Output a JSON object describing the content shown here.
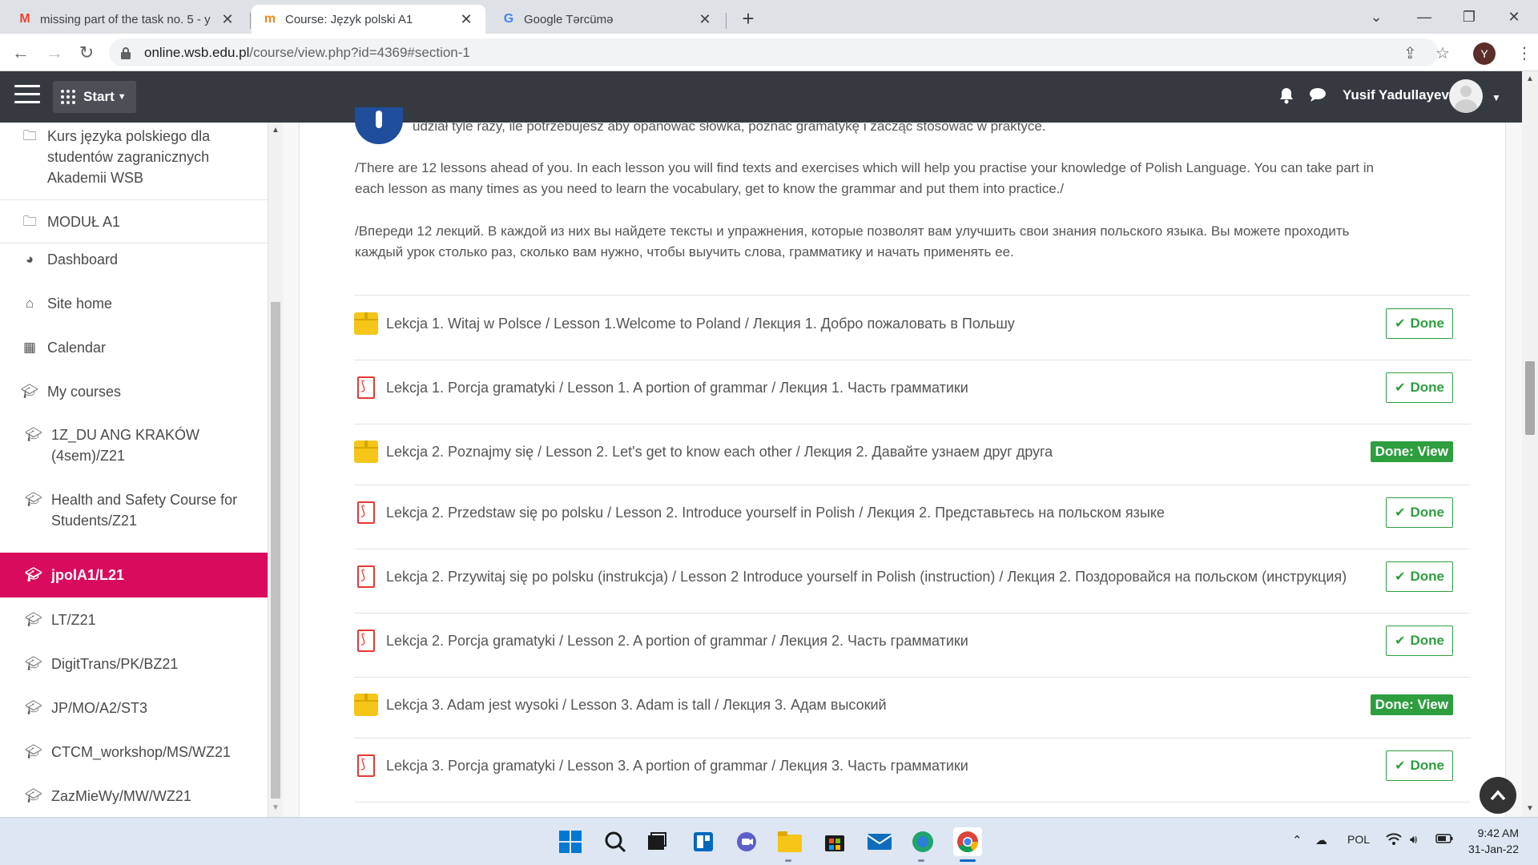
{
  "browser": {
    "tabs": [
      {
        "title": "missing part of the task no. 5 - y",
        "favicon": "gmail-icon",
        "active": false
      },
      {
        "title": "Course: Język polski A1",
        "favicon": "moodle-icon",
        "active": true
      },
      {
        "title": "Google Tərcümə",
        "favicon": "google-translate-icon",
        "active": false
      }
    ],
    "url_host": "online.wsb.edu.pl",
    "url_path": "/course/view.php?id=4369#section-1",
    "profile_initial": "Y"
  },
  "navbar": {
    "start_label": "Start",
    "user_name": "Yusif Yadullayev"
  },
  "drawer": {
    "items": [
      {
        "label": "Kurs języka polskiego dla studentów zagranicznych Akademii WSB",
        "icon": "folder-icon"
      },
      {
        "label": "MODUŁ A1",
        "icon": "folder-icon"
      },
      {
        "label": "Dashboard",
        "icon": "dashboard-icon"
      },
      {
        "label": "Site home",
        "icon": "home-icon"
      },
      {
        "label": "Calendar",
        "icon": "calendar-icon"
      },
      {
        "label": "My courses",
        "icon": "graduation-cap-icon"
      },
      {
        "label": "1Z_DU ANG KRAKÓW (4sem)/Z21",
        "icon": "graduation-cap-icon"
      },
      {
        "label": "Health and Safety Course for Students/Z21",
        "icon": "graduation-cap-icon"
      },
      {
        "label": "jpolA1/L21",
        "icon": "graduation-cap-icon",
        "active": true
      },
      {
        "label": "LT/Z21",
        "icon": "graduation-cap-icon"
      },
      {
        "label": "DigitTrans/PK/BZ21",
        "icon": "graduation-cap-icon"
      },
      {
        "label": "JP/MO/A2/ST3",
        "icon": "graduation-cap-icon"
      },
      {
        "label": "CTCM_workshop/MS/WZ21",
        "icon": "graduation-cap-icon"
      },
      {
        "label": "ZazMieWy/MW/WZ21",
        "icon": "graduation-cap-icon"
      }
    ]
  },
  "intro": {
    "polish_tail": "udział tyle razy, ile potrzebujesz aby opanować słówka, poznać gramatykę i zacząć stosować w praktyce.",
    "english_1": "/There are 12 lessons ahead of you. In each lesson you will find texts and exercises which will help you practise your knowledge of Polish Language. You can take part in",
    "english_2": "each lesson as many times as you need to learn the vocabulary, get to know the grammar and put them into practice./",
    "russian_1": "/Впереди 12 лекций. В каждой из них вы найдете тексты и упражнения, которые позволят вам улучшить свои знания польского языка. Вы можете проходить",
    "russian_2": "каждый урок столько раз, сколько вам нужно, чтобы выучить слова, грамматику и начать применять ее."
  },
  "activities": [
    {
      "name": "Lekcja 1. Witaj w Polsce / Lesson 1.Welcome to Poland / Лекция 1. Добро пожаловать в Польшу",
      "type": "folder",
      "status": "Done"
    },
    {
      "name": "Lekcja 1. Porcja gramatyki / Lesson 1. A portion of grammar / Лекция 1. Часть грамматики",
      "type": "pdf",
      "status": "Done"
    },
    {
      "name": "Lekcja 2. Poznajmy się / Lesson 2. Let's get to know each other / Лекция 2. Давайте узнаем друг друга",
      "type": "folder",
      "status": "Done: View"
    },
    {
      "name": "Lekcja 2. Przedstaw się po polsku / Lesson 2. Introduce yourself in Polish / Лекция 2. Представьтесь на польском языке",
      "type": "pdf",
      "status": "Done"
    },
    {
      "name": "Lekcja 2. Przywitaj się po polsku (instrukcja) / Lesson 2 Introduce yourself in Polish (instruction) / Лекция 2. Поздоровайся на польском (инструкция)",
      "type": "pdf",
      "status": "Done"
    },
    {
      "name": "Lekcja 2. Porcja gramatyki / Lesson 2. A portion of grammar / Лекция 2. Часть грамматики",
      "type": "pdf",
      "status": "Done"
    },
    {
      "name": "Lekcja 3. Adam jest wysoki / Lesson 3. Adam is tall / Лекция 3. Адам высокий",
      "type": "folder",
      "status": "Done: View"
    },
    {
      "name": "Lekcja 3. Porcja gramatyki / Lesson 3. A portion of grammar / Лекция 3. Часть грамматики",
      "type": "pdf",
      "status": "Done"
    }
  ],
  "taskbar": {
    "language": "POL",
    "time": "9:42 AM",
    "date": "31-Jan-22"
  },
  "colors": {
    "navbar": "#343a40",
    "drawer_active": "#d90b5d",
    "done": "#2e9e3f",
    "folder": "#f5c518",
    "pdf": "#e53935"
  }
}
